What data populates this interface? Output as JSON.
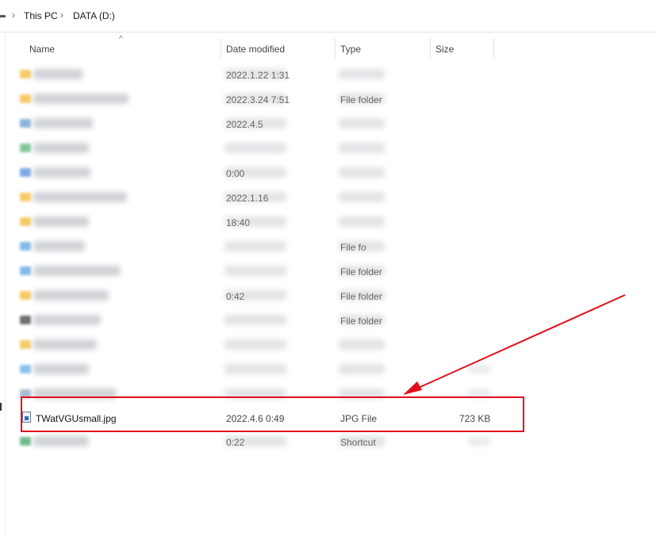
{
  "breadcrumb": {
    "items": [
      "This PC",
      "DATA (D:)"
    ],
    "separator": "›"
  },
  "columns": {
    "name": "Name",
    "date_modified": "Date modified",
    "type": "Type",
    "size": "Size"
  },
  "blurred_rows_visible_text": [
    {
      "date": "2022.1.22 1:31",
      "type": ""
    },
    {
      "date": "2022.3.24 7:51",
      "type": "File folder"
    },
    {
      "date": "2022.4.5",
      "type": ""
    },
    {
      "date": "",
      "type": ""
    },
    {
      "date": "0:00",
      "type": ""
    },
    {
      "date": "2022.1.16",
      "type": ""
    },
    {
      "date": "18:40",
      "type": ""
    },
    {
      "date": "",
      "type": "File fo"
    },
    {
      "date": "",
      "type": "File folder"
    },
    {
      "date": "0:42",
      "type": "File folder"
    },
    {
      "date": "",
      "type": "File folder"
    },
    {
      "date": "",
      "type": ""
    },
    {
      "date": "",
      "type": ""
    },
    {
      "date": "",
      "type": ""
    },
    {
      "date": "0:22",
      "type": "Shortcut"
    }
  ],
  "selected_file": {
    "name": "TWatVGUsmall.jpg",
    "date_modified": "2022.4.6 0:49",
    "type": "JPG File",
    "size": "723 KB"
  },
  "annotation": {
    "color": "#e0101a"
  },
  "icons": [
    "drive-icon",
    "folder-icon",
    "jpg-file-icon",
    "sort-up-icon"
  ]
}
